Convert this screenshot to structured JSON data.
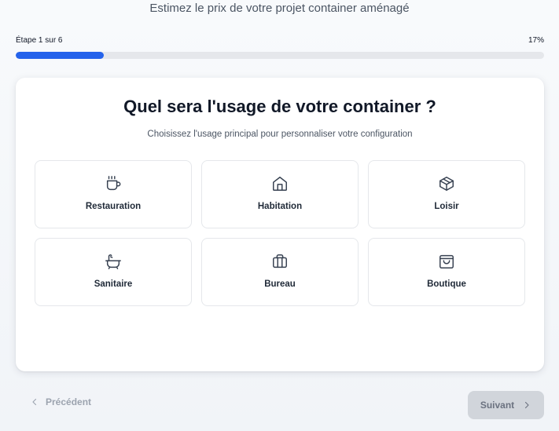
{
  "header": {
    "title": "Estimez le prix de votre projet container aménagé"
  },
  "progress": {
    "step_label": "Étape 1 sur 6",
    "percent_label": "17%",
    "fraction": 0.167,
    "color": "#2563eb"
  },
  "card": {
    "title": "Quel sera l'usage de votre container ?",
    "subtitle": "Choisissez l'usage principal pour personnaliser votre configuration"
  },
  "options": [
    {
      "label": "Restauration",
      "icon": "coffee-cup-icon"
    },
    {
      "label": "Habitation",
      "icon": "house-icon"
    },
    {
      "label": "Loisir",
      "icon": "box-icon"
    },
    {
      "label": "Sanitaire",
      "icon": "bathtub-icon"
    },
    {
      "label": "Bureau",
      "icon": "briefcase-icon"
    },
    {
      "label": "Boutique",
      "icon": "shopping-bag-icon"
    }
  ],
  "navigation": {
    "prev_label": "Précédent",
    "next_label": "Suivant"
  }
}
